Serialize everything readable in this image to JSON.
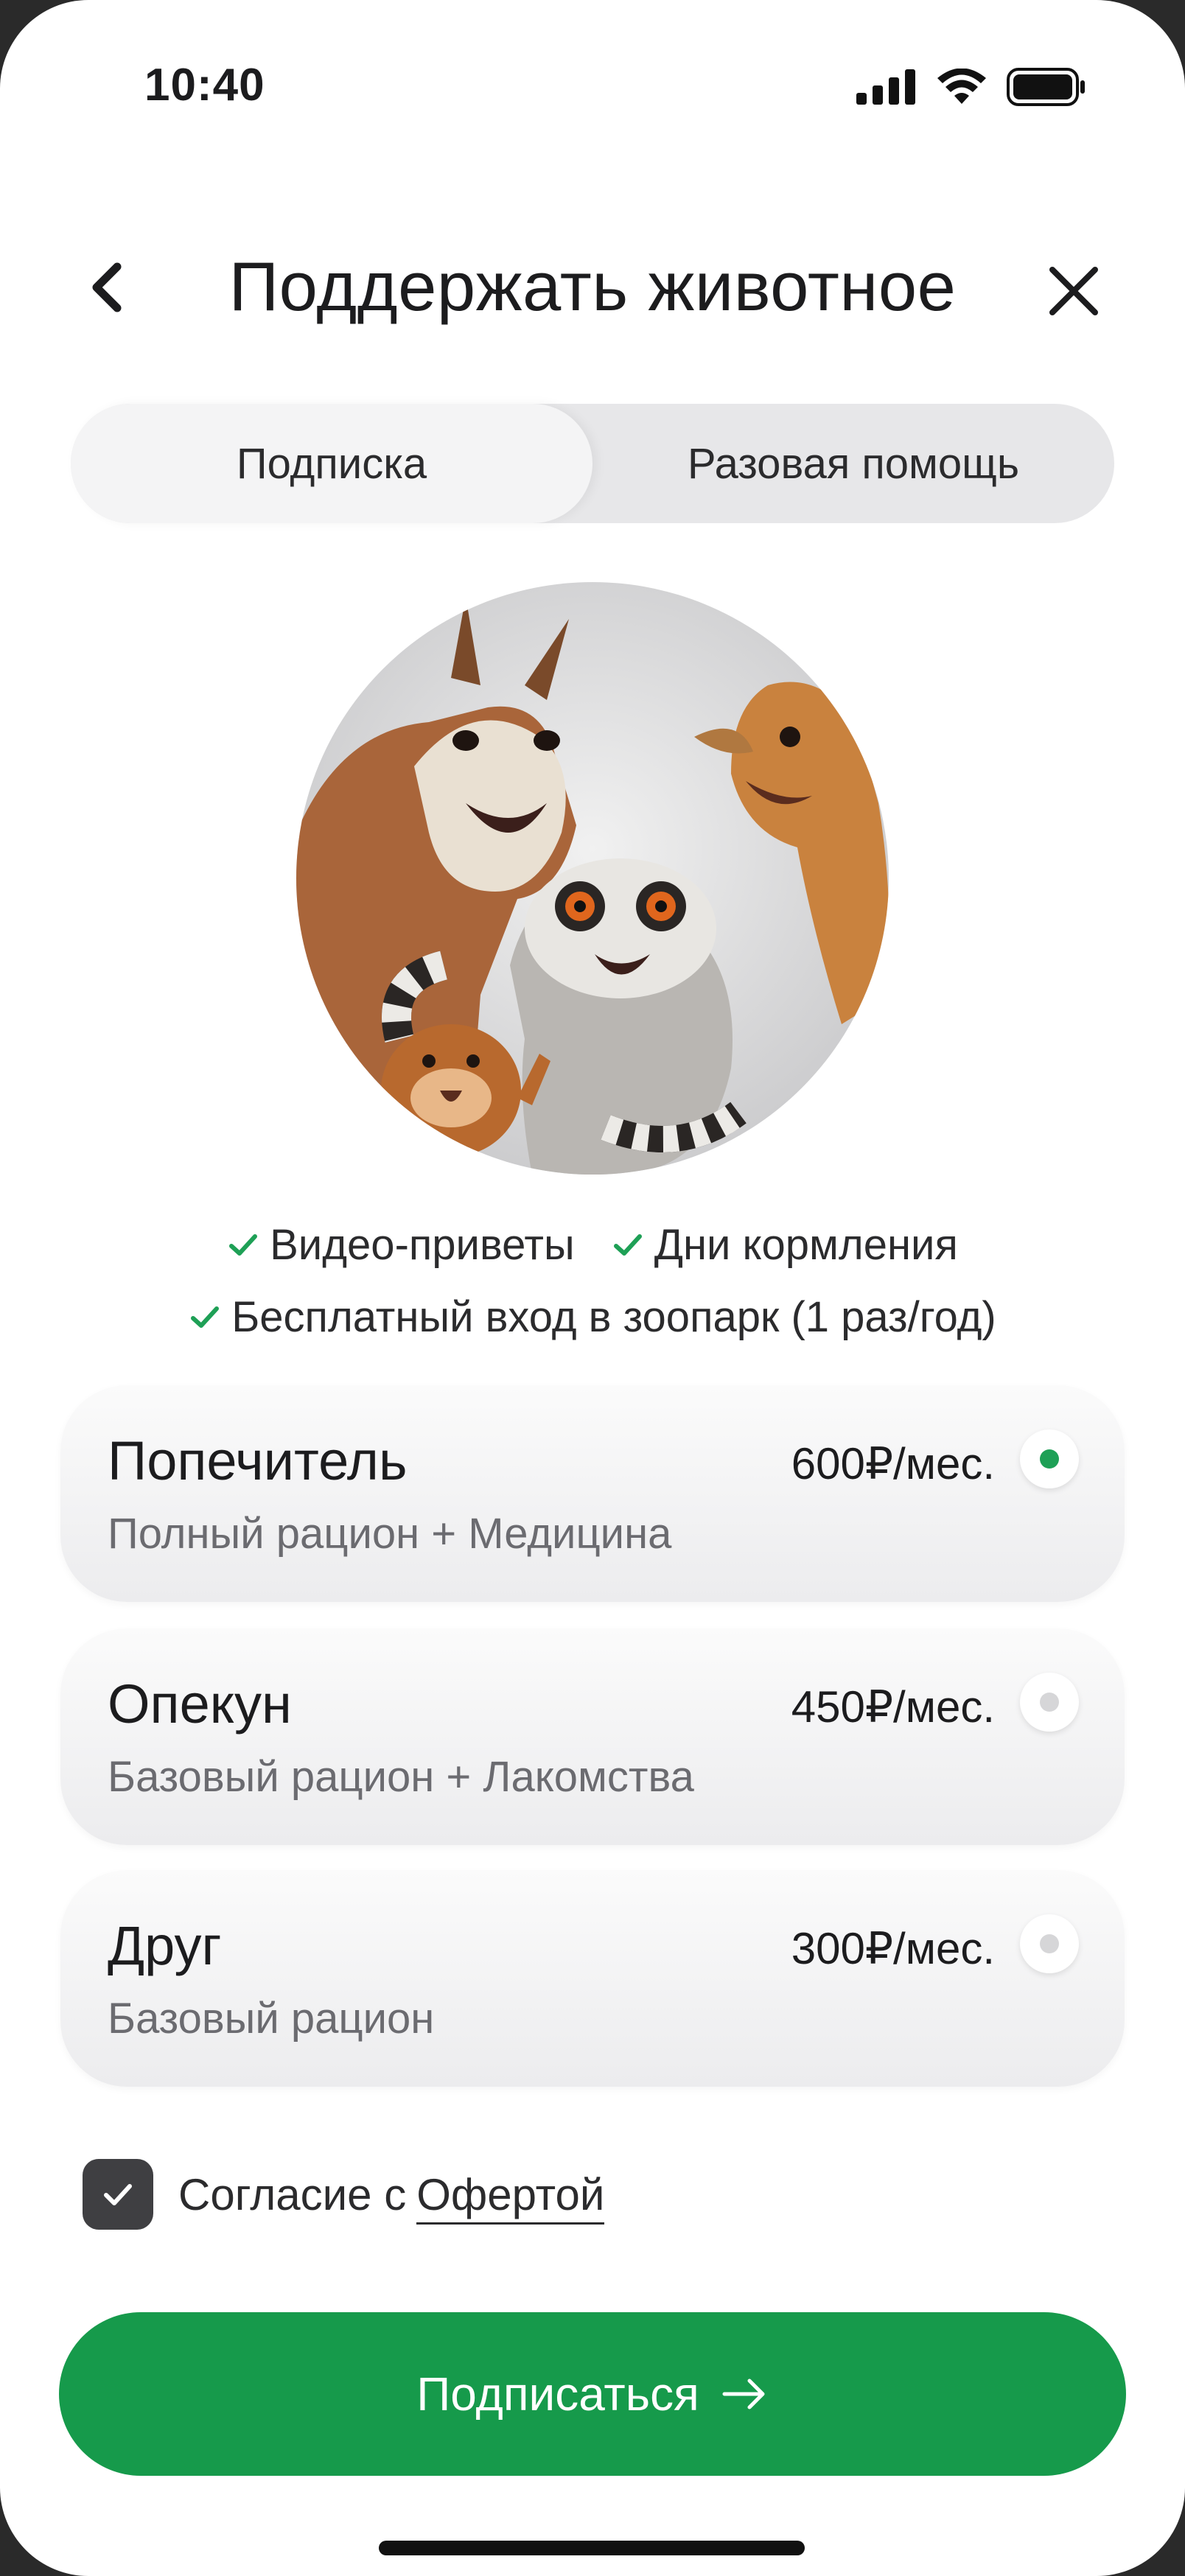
{
  "status_bar": {
    "time": "10:40"
  },
  "header": {
    "title": "Поддержать животное"
  },
  "tabs": {
    "active": "Подписка",
    "other": "Разовая помощь"
  },
  "benefits": [
    "Видео-приветы",
    "Дни кормления",
    "Бесплатный вход в зоопарк (1 раз/год)"
  ],
  "plans": [
    {
      "name": "Попечитель",
      "description": "Полный рацион + Медицина",
      "price": "600₽/мес.",
      "selected": true
    },
    {
      "name": "Опекун",
      "description": "Базовый рацион + Лакомства",
      "price": "450₽/мес.",
      "selected": false
    },
    {
      "name": "Друг",
      "description": "Базовый рацион",
      "price": "300₽/мес.",
      "selected": false
    }
  ],
  "consent": {
    "label": "Согласие с",
    "link": "Офертой",
    "checked": true
  },
  "cta": {
    "label": "Подписаться"
  },
  "colors": {
    "accent": "#169a4b",
    "radio_selected": "#1ea056",
    "checkbox": "#3f3f42"
  },
  "icons": {
    "back": "chevron-left-icon",
    "close": "close-icon",
    "check": "check-icon",
    "arrow": "arrow-right-icon"
  }
}
